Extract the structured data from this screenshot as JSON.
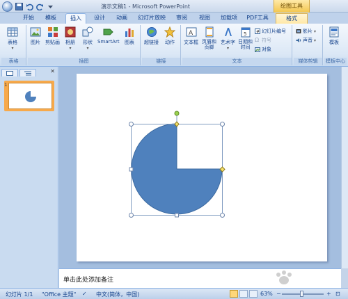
{
  "window": {
    "title": "演示文稿1 - Microsoft PowerPoint",
    "context_tool_group": "绘图工具"
  },
  "tabs": [
    {
      "label": "开始"
    },
    {
      "label": "模板"
    },
    {
      "label": "插入",
      "active": true
    },
    {
      "label": "设计"
    },
    {
      "label": "动画"
    },
    {
      "label": "幻灯片放映"
    },
    {
      "label": "审阅"
    },
    {
      "label": "视图"
    },
    {
      "label": "加载项"
    },
    {
      "label": "PDF工具"
    },
    {
      "label": "格式",
      "context": true
    }
  ],
  "ribbon": {
    "groups": {
      "tables": "表格",
      "illustrations": "插图",
      "links": "链接",
      "text": "文本",
      "media": "媒体剪辑",
      "template_center": "模板中心"
    },
    "buttons": {
      "table": "表格",
      "picture": "图片",
      "clipart": "剪贴画",
      "album": "相册",
      "shapes": "形状",
      "smartart": "SmartArt",
      "chart": "图表",
      "hyperlink": "超链接",
      "action": "动作",
      "textbox": "文本框",
      "header_footer": "页眉和\n页脚",
      "wordart": "艺术字",
      "datetime": "日期和\n时间",
      "slide_number": "幻灯片编号",
      "symbol": "符号",
      "object": "对象",
      "movie": "影片",
      "sound": "声音",
      "template": "模板"
    }
  },
  "slide_pane": {
    "slide_number": "1"
  },
  "notes": {
    "placeholder": "单击此处添加备注"
  },
  "status_bar": {
    "slide_info": "幻灯片 1/1",
    "theme": "\"Office 主题\"",
    "language": "中文(简体，中国)",
    "zoom": "63%"
  },
  "colors": {
    "shape_fill": "#4f81bd",
    "shape_stroke": "#3c6aa0",
    "handle_yellow": "#f5e16c",
    "handle_green": "#9bd14f",
    "selection_line": "#7f9bc0"
  }
}
